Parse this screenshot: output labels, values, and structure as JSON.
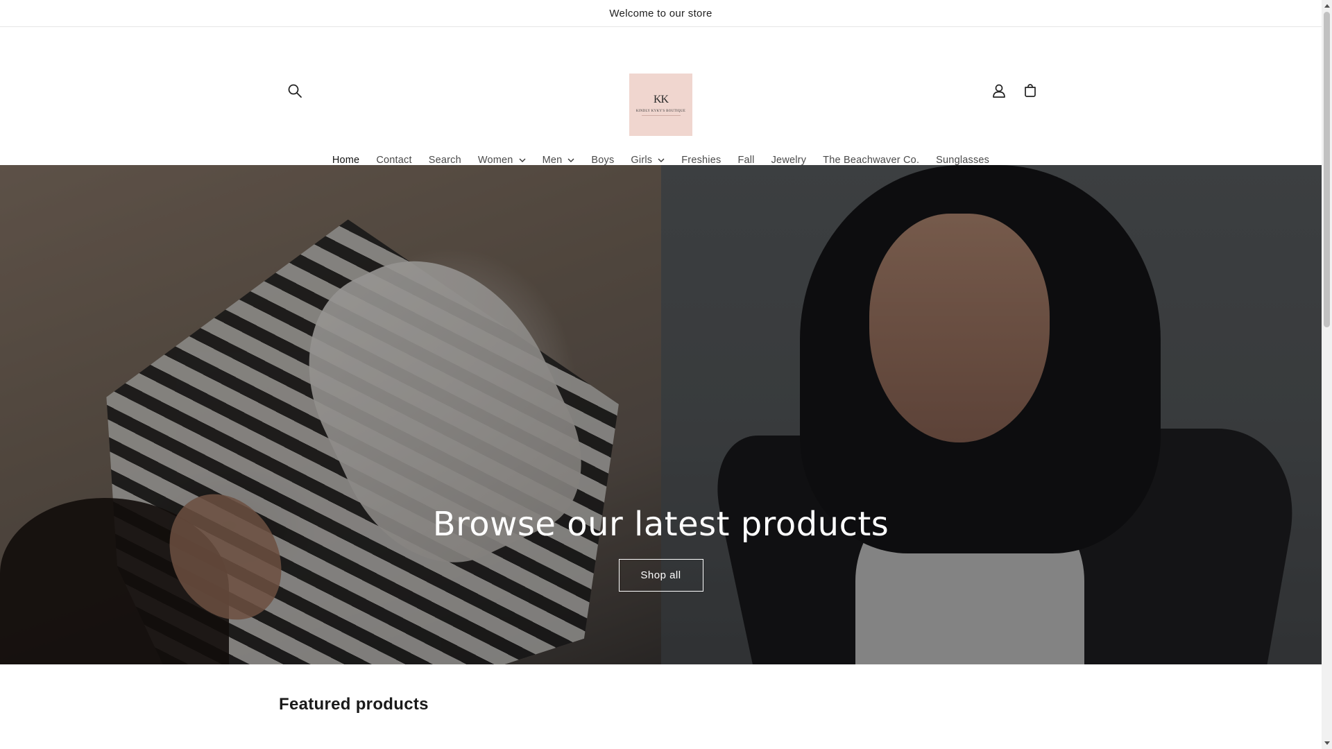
{
  "announcement": {
    "text": "Welcome to our store"
  },
  "header": {
    "logo": {
      "mark": "KK",
      "subtitle": "KINDLY KYKY'S BOUTIQUE"
    },
    "icons": {
      "search": "search-icon",
      "account": "account-icon",
      "cart": "cart-icon"
    }
  },
  "nav": {
    "items": [
      {
        "label": "Home",
        "active": true,
        "dropdown": false
      },
      {
        "label": "Contact",
        "active": false,
        "dropdown": false
      },
      {
        "label": "Search",
        "active": false,
        "dropdown": false
      },
      {
        "label": "Women",
        "active": false,
        "dropdown": true
      },
      {
        "label": "Men",
        "active": false,
        "dropdown": true
      },
      {
        "label": "Boys",
        "active": false,
        "dropdown": false
      },
      {
        "label": "Girls",
        "active": false,
        "dropdown": true
      },
      {
        "label": "Freshies",
        "active": false,
        "dropdown": false
      },
      {
        "label": "Fall",
        "active": false,
        "dropdown": false
      },
      {
        "label": "Jewelry",
        "active": false,
        "dropdown": false
      },
      {
        "label": "The Beachwaver Co.",
        "active": false,
        "dropdown": false
      },
      {
        "label": "Sunglasses",
        "active": false,
        "dropdown": false
      }
    ]
  },
  "hero": {
    "heading": "Browse our latest products",
    "button_label": "Shop all"
  },
  "featured": {
    "title": "Featured products"
  },
  "colors": {
    "logo_bg": "#f0d6cf",
    "text": "#121212",
    "nav_text": "#4a4a4a",
    "white": "#ffffff"
  }
}
